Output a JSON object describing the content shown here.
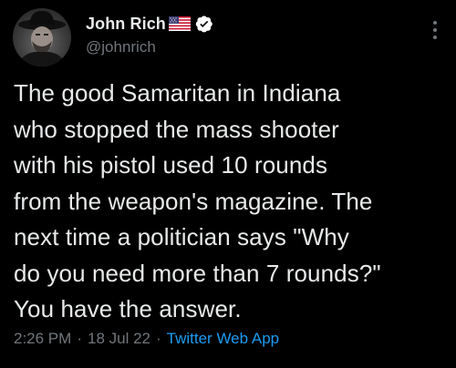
{
  "author": {
    "display_name": "John Rich",
    "handle": "@johnrich",
    "badges": [
      "us-flag-icon",
      "verified-badge-icon"
    ]
  },
  "tweet": {
    "text": "The good Samaritan in Indiana\nwho stopped the mass shooter\nwith his pistol used 10 rounds\nfrom the weapon's magazine. The\nnext time a politician says \"Why\ndo you need more than 7 rounds?\"\nYou have the answer.",
    "time": "2:26 PM",
    "separator": "·",
    "date": "18 Jul 22",
    "source": "Twitter Web App"
  },
  "colors": {
    "background": "#000000",
    "primary_text": "#e7e9ea",
    "secondary_text": "#71767b",
    "link": "#1d9bf0",
    "verified": "#ffffff"
  }
}
